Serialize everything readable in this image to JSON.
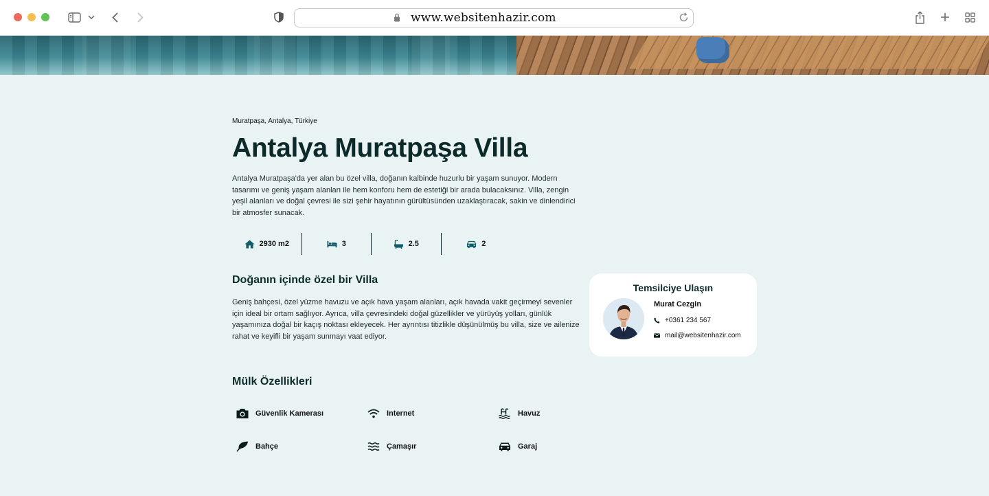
{
  "browser": {
    "url": "www.websitenhazir.com",
    "icons": [
      "sidebar-icon",
      "chevron-down-icon",
      "back-icon",
      "forward-icon",
      "shield-icon",
      "lock-icon",
      "reload-icon",
      "share-icon",
      "plus-icon",
      "tabs-grid-icon"
    ]
  },
  "property": {
    "location": "Muratpaşa, Antalya, Türkiye",
    "title": "Antalya Muratpaşa Villa",
    "description": "Antalya Muratpaşa'da yer alan bu özel villa, doğanın kalbinde huzurlu bir yaşam sunuyor. Modern tasarımı ve geniş yaşam alanları ile hem konforu hem de estetiği bir arada bulacaksınız. Villa, zengin yeşil alanları ve doğal çevresi ile sizi şehir hayatının gürültüsünden uzaklaştıracak, sakin ve dinlendirici bir atmosfer sunacak.",
    "stats": [
      {
        "icon": "home-icon",
        "value": "2930 m2"
      },
      {
        "icon": "bed-icon",
        "value": "3"
      },
      {
        "icon": "bath-icon",
        "value": "2.5"
      },
      {
        "icon": "car-icon",
        "value": "2"
      }
    ]
  },
  "section": {
    "heading": "Doğanın içinde özel bir Villa",
    "text": "Geniş bahçesi, özel yüzme havuzu ve açık hava yaşam alanları, açık havada vakit geçirmeyi sevenler için ideal bir ortam sağlıyor. Ayrıca, villa çevresindeki doğal güzellikler ve yürüyüş yolları, günlük yaşamınıza doğal bir kaçış noktası ekleyecek. Her ayrıntısı titizlikle düşünülmüş bu villa, size ve ailenize rahat ve keyifli bir yaşam sunmayı vaat ediyor."
  },
  "features": {
    "heading": "Mülk Özellikleri",
    "items": [
      {
        "icon": "camera-icon",
        "label": "Güvenlik Kamerası"
      },
      {
        "icon": "wifi-icon",
        "label": "Internet"
      },
      {
        "icon": "pool-icon",
        "label": "Havuz"
      },
      {
        "icon": "leaf-icon",
        "label": "Bahçe"
      },
      {
        "icon": "water-waves-icon",
        "label": "Çamaşır"
      },
      {
        "icon": "car-icon",
        "label": "Garaj"
      }
    ]
  },
  "agent": {
    "card_title": "Temsilciye Ulaşın",
    "name": "Murat Cezgin",
    "phone": "+0361 234 567",
    "email": "mail@websitenhazir.com"
  },
  "colors": {
    "page_bg": "#e9f3f3",
    "heading": "#0c2a2a",
    "accent": "#0f5e6a",
    "card_bg": "#ffffff"
  }
}
